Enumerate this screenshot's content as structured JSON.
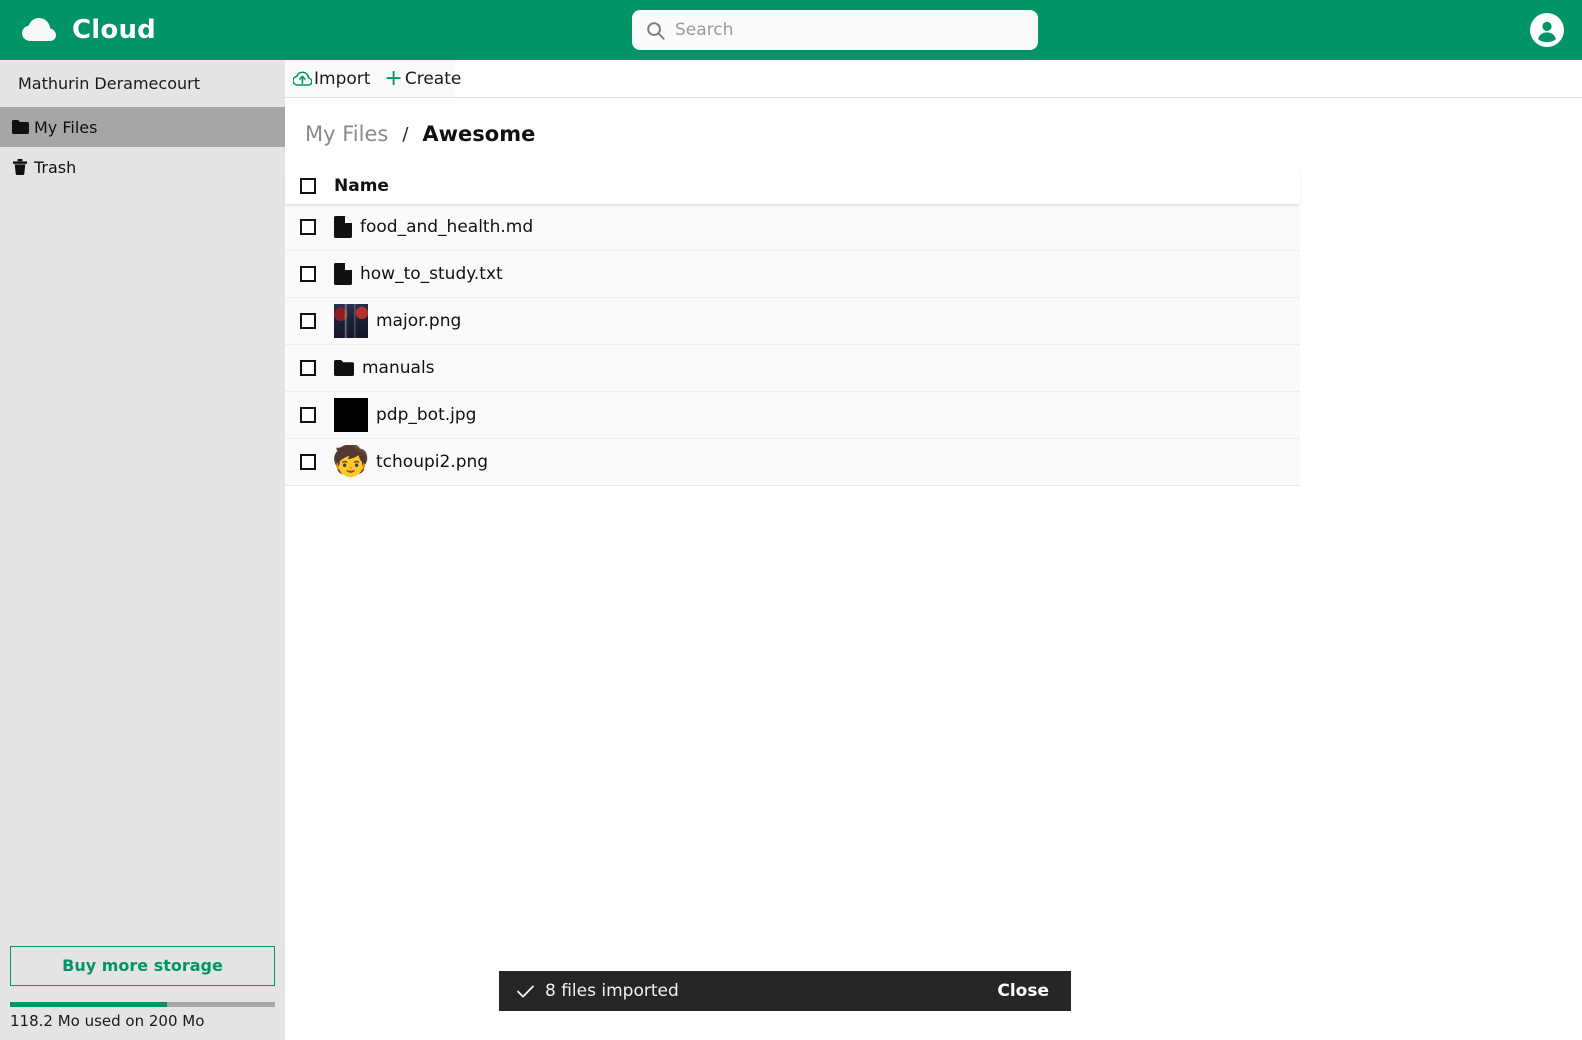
{
  "header": {
    "brand_title": "Cloud",
    "brand_icon": "cloud-icon",
    "search": {
      "placeholder": "Search",
      "value": "",
      "icon": "search-icon"
    },
    "account_icon": "user-avatar-icon",
    "background_color": "#019467"
  },
  "sidebar": {
    "user_name": "Mathurin Deramecourt",
    "items": [
      {
        "label": "My Files",
        "icon": "folder-icon",
        "active": true
      },
      {
        "label": "Trash",
        "icon": "trash-icon",
        "active": false
      }
    ],
    "storage": {
      "buy_label": "Buy more storage",
      "usage_text": "118.2 Mo used on 200 Mo",
      "used": 118.2,
      "total": 200,
      "percent": 59.1,
      "accent_color": "#019467"
    }
  },
  "toolbar": {
    "import_label": "Import",
    "import_icon": "cloud-upload-icon",
    "create_label": "Create",
    "create_icon": "plus-icon"
  },
  "breadcrumb": {
    "root_label": "My Files",
    "separator": "/",
    "current_label": "Awesome"
  },
  "table": {
    "columns": [
      "Name"
    ],
    "select_all_checked": false,
    "rows": [
      {
        "name": "food_and_health.md",
        "icon": "file-icon",
        "kind": "file",
        "checked": false
      },
      {
        "name": "how_to_study.txt",
        "icon": "file-icon",
        "kind": "file",
        "checked": false
      },
      {
        "name": "major.png",
        "icon": "image-thumbnail",
        "kind": "image",
        "checked": false
      },
      {
        "name": "manuals",
        "icon": "folder-icon",
        "kind": "folder",
        "checked": false
      },
      {
        "name": "pdp_bot.jpg",
        "icon": "image-thumbnail",
        "kind": "image",
        "thumb_glyph": "😢",
        "checked": false
      },
      {
        "name": "tchoupi2.png",
        "icon": "image-thumbnail",
        "kind": "image",
        "thumb_glyph": "🧒",
        "checked": false
      }
    ]
  },
  "toast": {
    "icon": "check-icon",
    "message": "8 files imported",
    "close_label": "Close",
    "background_color": "#262626"
  }
}
